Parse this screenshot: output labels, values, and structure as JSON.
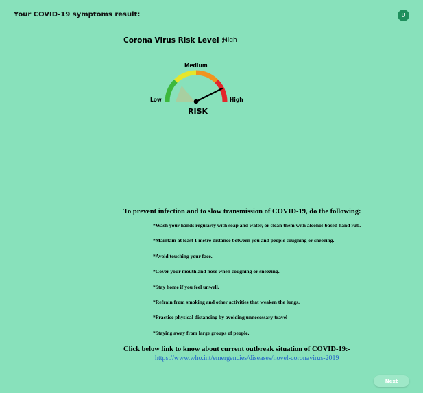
{
  "header": {
    "title": "Your COVID-19 symptoms result:",
    "avatar_letter": "U"
  },
  "risk": {
    "heading": "Corona Virus Risk Level :-",
    "value": "High",
    "gauge": {
      "label_low": "Low",
      "label_medium": "Medium",
      "label_high": "High",
      "label_center": "RISK",
      "level": "High",
      "colors": {
        "low": "#3cb83c",
        "medium_low": "#e6e62a",
        "medium_high": "#f0941e",
        "high": "#e3262a"
      }
    }
  },
  "prevention": {
    "heading": "To prevent infection and to slow transmission of COVID-19, do the following:",
    "tips": [
      "*Wash your hands regularly with soap and water, or clean them with alcohol-based hand rub.",
      "*Maintain at least 1 metre distance between you and people coughing or sneezing.",
      "*Avoid touching your face.",
      "*Cover your mouth and nose when coughing or sneezing.",
      "*Stay home if you feel unwell.",
      "*Refrain from smoking and other activities that weaken the lungs.",
      "*Practice physical distancing by avoiding unnecessary travel",
      "*Staying away from large groups of people."
    ]
  },
  "outbreak": {
    "heading": "Click below link to know about current outbreak situation of COVID-19:-",
    "link_text": "https://www.who.int/emergencies/diseases/novel-coronavirus-2019"
  },
  "footer": {
    "next_label": "Next"
  }
}
